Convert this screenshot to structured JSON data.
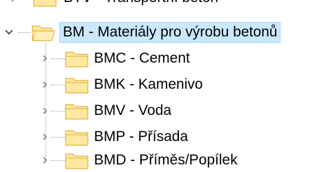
{
  "tree": {
    "partial_top_label": "BTV - Transportní beton",
    "parent": {
      "label": "BM - Materiály pro výrobu betonů",
      "expanded": true,
      "selected": true
    },
    "children": [
      {
        "label": "BMC - Cement"
      },
      {
        "label": "BMK - Kamenivo"
      },
      {
        "label": "BMV - Voda"
      },
      {
        "label": "BMP - Přísada"
      },
      {
        "label": "BMD - Příměs/Popílek"
      }
    ]
  },
  "colors": {
    "selection_bg": "#cce8ff",
    "selection_border": "#99d1ff",
    "folder_fill": "#ffe8a0",
    "folder_edge": "#e2b23c",
    "chevron": "#808080"
  },
  "icons": {
    "collapsed": "chevron-right-icon",
    "expanded": "chevron-down-icon",
    "node": "folder-icon"
  }
}
